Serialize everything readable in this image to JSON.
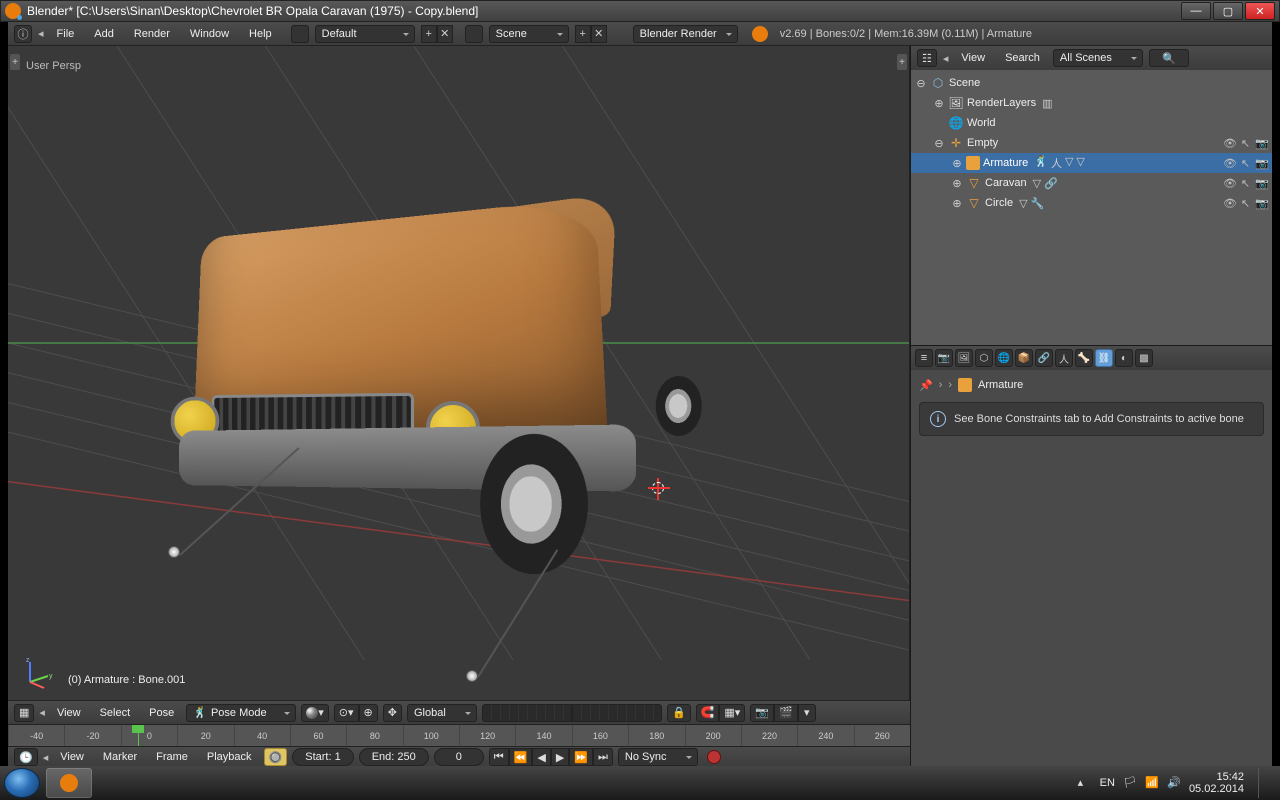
{
  "windowTitle": "Blender* [C:\\Users\\Sinan\\Desktop\\Chevrolet BR Opala Caravan (1975) - Copy.blend]",
  "info": {
    "menus": {
      "file": "File",
      "add": "Add",
      "render": "Render",
      "window": "Window",
      "help": "Help"
    },
    "layoutName": "Default",
    "sceneName": "Scene",
    "engine": "Blender Render",
    "stats": "v2.69 | Bones:0/2 | Mem:16.39M (0.11M) | Armature"
  },
  "view3d": {
    "perspLabel": "User Persp",
    "selectedLabel": "(0) Armature : Bone.001",
    "menus": {
      "view": "View",
      "select": "Select",
      "pose": "Pose"
    },
    "mode": "Pose Mode",
    "orientation": "Global"
  },
  "timeline": {
    "menus": {
      "view": "View",
      "marker": "Marker",
      "frame": "Frame",
      "playback": "Playback"
    },
    "start": "Start: 1",
    "end": "End: 250",
    "current": "0",
    "sync": "No Sync",
    "ticks": [
      "-40",
      "-20",
      "0",
      "20",
      "40",
      "60",
      "80",
      "100",
      "120",
      "140",
      "160",
      "180",
      "200",
      "220",
      "240",
      "260"
    ]
  },
  "outliner": {
    "menus": {
      "view": "View",
      "search": "Search"
    },
    "filter": "All Scenes",
    "tree": {
      "scene": "Scene",
      "renderlayers": "RenderLayers",
      "world": "World",
      "empty": "Empty",
      "armature": "Armature",
      "caravan": "Caravan",
      "circle": "Circle"
    }
  },
  "props": {
    "crumb": "Armature",
    "msg": "See Bone Constraints tab to Add Constraints to active bone"
  },
  "taskbar": {
    "lang": "EN",
    "time": "15:42",
    "date": "05.02.2014"
  }
}
